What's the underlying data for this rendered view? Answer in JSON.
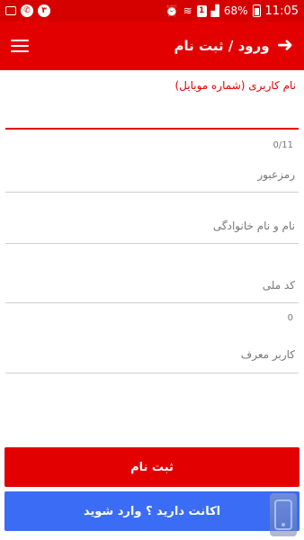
{
  "status_bar": {
    "left_icons": [
      "image-icon",
      "whatsapp-icon",
      "notification-count-icon"
    ],
    "notification_count": "۳",
    "time": "11:05",
    "battery": "68%",
    "sim_indicator": "1"
  },
  "app_bar": {
    "title": "ورود / ثبت نام",
    "menu_icon": "hamburger-menu-icon",
    "back_icon": "arrow-right-icon"
  },
  "form": {
    "username_label": "نام کاربری (شماره موبایل)",
    "username_value": "",
    "username_counter": "0/11",
    "password_placeholder": "رمزعبور",
    "fullname_placeholder": "نام و نام خانوادگی",
    "national_code_placeholder": "کد ملی",
    "national_code_counter": "0",
    "referrer_placeholder": "کاربر معرف"
  },
  "buttons": {
    "register_label": "ثبت نام",
    "login_label": "اکانت دارید ؟ وارد شوید"
  },
  "colors": {
    "primary": "#e30000",
    "status_bar": "#d50000",
    "login_button": "#3b6cf5"
  }
}
